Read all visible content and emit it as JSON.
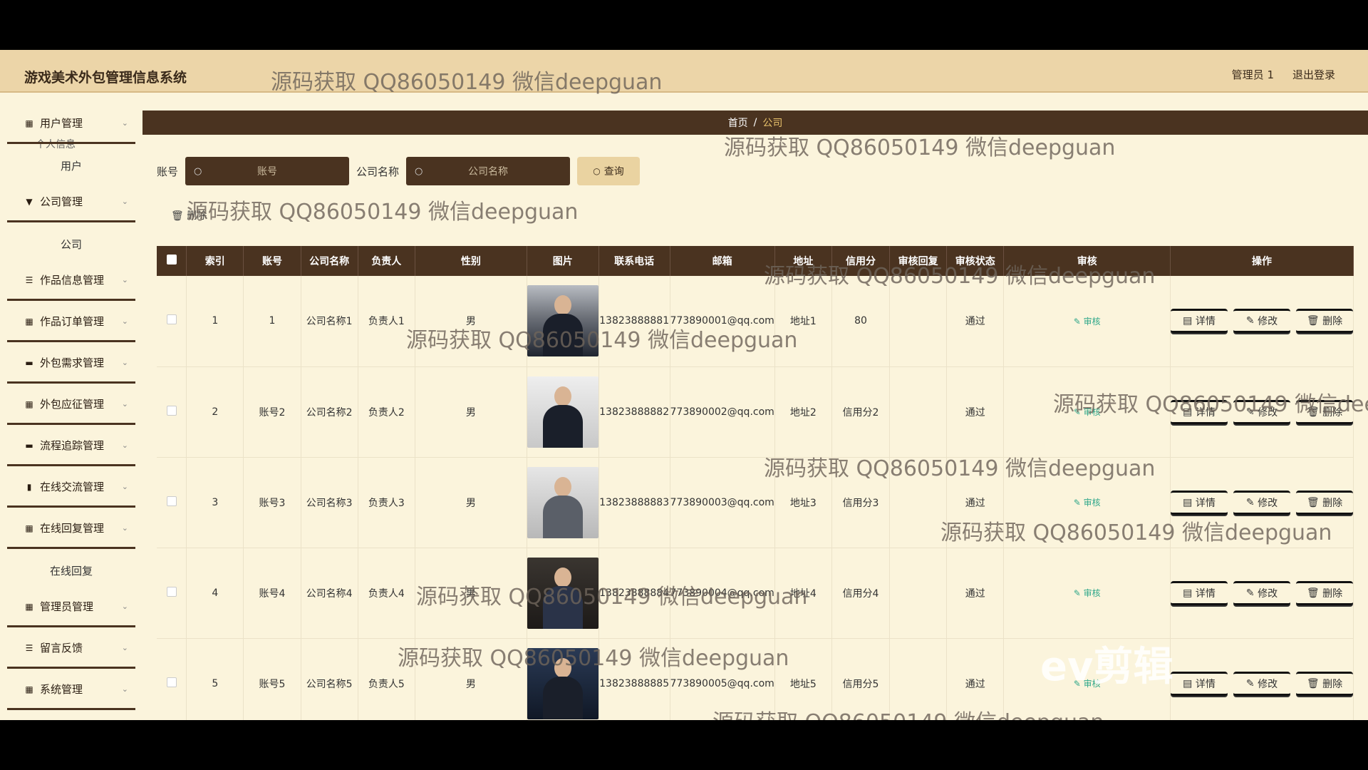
{
  "app": {
    "title": "游戏美术外包管理信息系统"
  },
  "header": {
    "user": "管理员 1",
    "logout": "退出登录"
  },
  "sidebar": {
    "cut_label": "个人信息",
    "items": [
      {
        "label": "用户管理",
        "icon": "grid-icon"
      },
      {
        "label": "用户",
        "sub": true
      },
      {
        "label": "公司管理",
        "icon": "pin-icon"
      },
      {
        "label": "公司",
        "sub": true
      },
      {
        "label": "作品信息管理",
        "icon": "list-icon"
      },
      {
        "label": "作品订单管理",
        "icon": "grid-icon"
      },
      {
        "label": "外包需求管理",
        "icon": "monitor-icon"
      },
      {
        "label": "外包应征管理",
        "icon": "grid-icon"
      },
      {
        "label": "流程追踪管理",
        "icon": "monitor-icon"
      },
      {
        "label": "在线交流管理",
        "icon": "bar-icon"
      },
      {
        "label": "在线回复管理",
        "icon": "grid-icon"
      },
      {
        "label": "在线回复",
        "sub": true
      },
      {
        "label": "管理员管理",
        "icon": "grid-icon"
      },
      {
        "label": "留言反馈",
        "icon": "list-icon"
      },
      {
        "label": "系统管理",
        "icon": "grid-icon"
      }
    ]
  },
  "breadcrumb": {
    "home": "首页",
    "sep": "/",
    "current": "公司"
  },
  "search": {
    "account_label": "账号",
    "account_placeholder": "账号",
    "company_label": "公司名称",
    "company_placeholder": "公司名称",
    "query": "查询"
  },
  "toolbar": {
    "delete": "删除"
  },
  "table": {
    "headers": [
      "索引",
      "账号",
      "公司名称",
      "负责人",
      "性别",
      "图片",
      "联系电话",
      "邮箱",
      "地址",
      "信用分",
      "审核回复",
      "审核状态",
      "审核",
      "操作"
    ],
    "rows": [
      {
        "index": "1",
        "account": "1",
        "company": "公司名称1",
        "owner": "负责人1",
        "gender": "男",
        "phone": "13823888881",
        "email": "773890001@qq.com",
        "address": "地址1",
        "credit": "80",
        "reply": "",
        "status": "通过",
        "audit": "审核"
      },
      {
        "index": "2",
        "account": "账号2",
        "company": "公司名称2",
        "owner": "负责人2",
        "gender": "男",
        "phone": "13823888882",
        "email": "773890002@qq.com",
        "address": "地址2",
        "credit": "信用分2",
        "reply": "",
        "status": "通过",
        "audit": "审核"
      },
      {
        "index": "3",
        "account": "账号3",
        "company": "公司名称3",
        "owner": "负责人3",
        "gender": "男",
        "phone": "13823888883",
        "email": "773890003@qq.com",
        "address": "地址3",
        "credit": "信用分3",
        "reply": "",
        "status": "通过",
        "audit": "审核"
      },
      {
        "index": "4",
        "account": "账号4",
        "company": "公司名称4",
        "owner": "负责人4",
        "gender": "男",
        "phone": "13823888884",
        "email": "773890004@qq.com",
        "address": "地址4",
        "credit": "信用分4",
        "reply": "",
        "status": "通过",
        "audit": "审核"
      },
      {
        "index": "5",
        "account": "账号5",
        "company": "公司名称5",
        "owner": "负责人5",
        "gender": "男",
        "phone": "13823888885",
        "email": "773890005@qq.com",
        "address": "地址5",
        "credit": "信用分5",
        "reply": "",
        "status": "通过",
        "audit": "审核"
      }
    ],
    "ops": {
      "detail": "详情",
      "edit": "修改",
      "delete": "删除"
    }
  },
  "watermark": {
    "text": "源码获取 QQ86050149 微信deepguan",
    "logo": "ev剪辑"
  }
}
